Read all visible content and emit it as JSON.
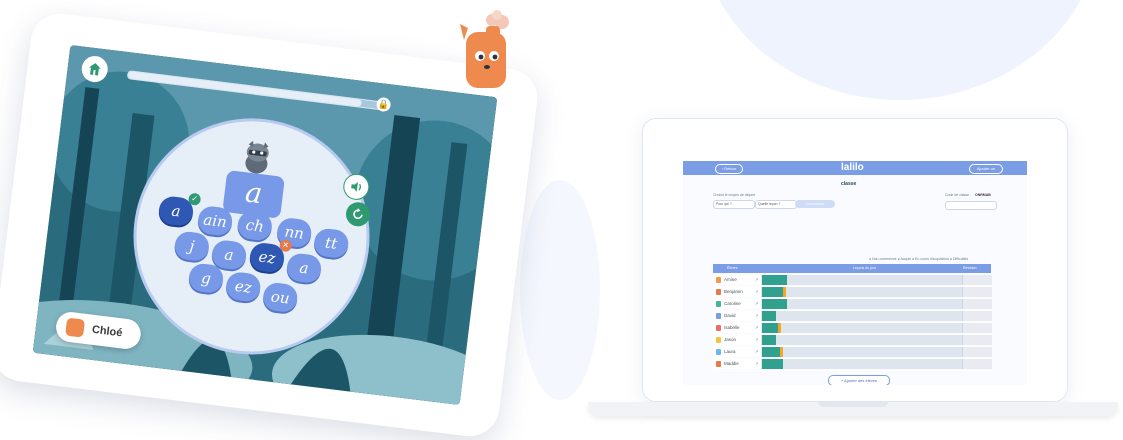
{
  "tablet": {
    "student_name": "Chloé",
    "progress_fraction": 0.92,
    "target_letter": "a",
    "choices": [
      {
        "label": "a",
        "state": "correct"
      },
      {
        "label": "ain",
        "state": ""
      },
      {
        "label": "ch",
        "state": ""
      },
      {
        "label": "nn",
        "state": ""
      },
      {
        "label": "tt",
        "state": ""
      },
      {
        "label": "j",
        "state": ""
      },
      {
        "label": "a",
        "state": ""
      },
      {
        "label": "ez",
        "state": "wrong"
      },
      {
        "label": "a",
        "state": ""
      },
      {
        "label": "g",
        "state": ""
      },
      {
        "label": "ez",
        "state": ""
      },
      {
        "label": "ou",
        "state": ""
      }
    ],
    "icons": {
      "home": "home-icon",
      "lock": "lock-icon",
      "sound": "speaker-icon",
      "replay": "replay-icon",
      "animal": "raccoon-icon",
      "user": "avatar-icon"
    },
    "lock_glyph": "🔒",
    "ok_glyph": "✓",
    "err_glyph": "✕"
  },
  "dashboard": {
    "logo": "lalilo",
    "back_label": "‹ Retour",
    "right_button": "Ajouter un élève",
    "class_title": "classe",
    "filter_label": "Choisir le moyen de départ",
    "select_1": "Pour qui ?",
    "select_2": "Quelle leçon ?",
    "apply_label": "Commencer",
    "class_code_label": "Code de classe",
    "class_code": "ONRMAB",
    "legend": "● Non commencé  ● Acquis  ● En cours d'acquisition  ● Difficultés",
    "col_students": "Élèves",
    "col_lessons": "Leçons du jour",
    "col_extra": "Révision",
    "students": [
      {
        "name": "Amine",
        "progress": 0.11,
        "flag": false,
        "color": "#f2994a"
      },
      {
        "name": "Benjamin",
        "progress": 0.09,
        "flag": true,
        "color": "#e57b4b"
      },
      {
        "name": "Caroline",
        "progress": 0.11,
        "flag": false,
        "color": "#3fb79a"
      },
      {
        "name": "David",
        "progress": 0.06,
        "flag": false,
        "color": "#7b9de6"
      },
      {
        "name": "Isabelle",
        "progress": 0.07,
        "flag": true,
        "color": "#ef6a6a"
      },
      {
        "name": "Jason",
        "progress": 0.06,
        "flag": false,
        "color": "#f5c342"
      },
      {
        "name": "Laura",
        "progress": 0.08,
        "flag": true,
        "color": "#6fb7e8"
      },
      {
        "name": "Maddie",
        "progress": 0.09,
        "flag": false,
        "color": "#e57b4b"
      }
    ],
    "add_students": "+ Ajouter des élèves"
  },
  "colors": {
    "accent": "#7b9de6",
    "green": "#2fa18e",
    "orange": "#f5a623"
  }
}
